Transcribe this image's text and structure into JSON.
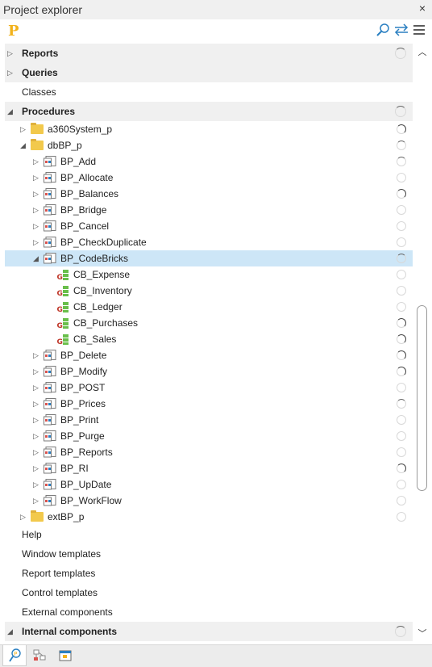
{
  "window": {
    "title": "Project explorer",
    "close_glyph": "×"
  },
  "toolbar": {
    "logo_letter": "P",
    "icons": [
      "search-icon",
      "sync-arrows-icon",
      "menu-icon"
    ],
    "colors": {
      "logo": "#f2b21b",
      "accent": "#2a7fc1"
    }
  },
  "tree": {
    "sections_top": [
      {
        "label": "Reports",
        "expanded": false
      },
      {
        "label": "Queries",
        "expanded": false
      },
      {
        "label": "Classes"
      },
      {
        "label": "Procedures",
        "expanded": true
      }
    ],
    "folders": {
      "a360": {
        "label": "a360System_p"
      },
      "dbbp": {
        "label": "dbBP_p"
      },
      "extbp": {
        "label": "extBP_p"
      }
    },
    "procedures_before": [
      {
        "label": "BP_Add"
      },
      {
        "label": "BP_Allocate"
      },
      {
        "label": "BP_Balances"
      },
      {
        "label": "BP_Bridge"
      },
      {
        "label": "BP_Cancel"
      },
      {
        "label": "BP_CheckDuplicate"
      }
    ],
    "selected": {
      "label": "BP_CodeBricks"
    },
    "codebricks": [
      {
        "label": "CB_Expense"
      },
      {
        "label": "CB_Inventory"
      },
      {
        "label": "CB_Ledger"
      },
      {
        "label": "CB_Purchases"
      },
      {
        "label": "CB_Sales"
      }
    ],
    "procedures_after": [
      {
        "label": "BP_Delete"
      },
      {
        "label": "BP_Modify"
      },
      {
        "label": "BP_POST"
      },
      {
        "label": "BP_Prices"
      },
      {
        "label": "BP_Print"
      },
      {
        "label": "BP_Purge"
      },
      {
        "label": "BP_Reports"
      },
      {
        "label": "BP_RI"
      },
      {
        "label": "BP_UpDate"
      },
      {
        "label": "BP_WorkFlow"
      }
    ],
    "sections_bottom": [
      {
        "label": "Help"
      },
      {
        "label": "Window templates"
      },
      {
        "label": "Report templates"
      },
      {
        "label": "Control templates"
      },
      {
        "label": "External components"
      },
      {
        "label": "Internal components",
        "expanded": true
      }
    ]
  },
  "bottom_tabs": [
    "project-explorer-tab-icon",
    "diagram-tab-icon",
    "window-tab-icon"
  ]
}
